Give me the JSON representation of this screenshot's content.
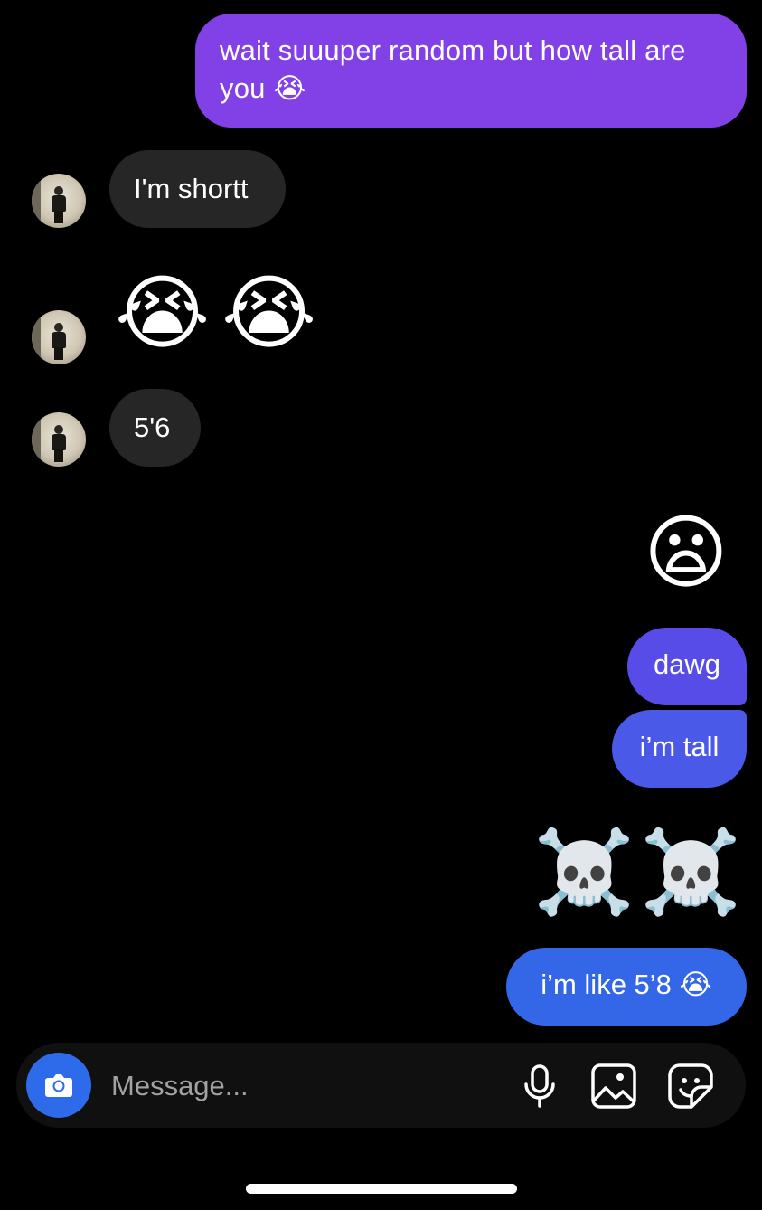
{
  "messages": [
    {
      "sender": "me",
      "text": "wait suuuper random but how tall are you",
      "emoji": "😭"
    },
    {
      "sender": "them",
      "text": "I'm shortt"
    },
    {
      "sender": "them",
      "emoji": [
        "😭",
        "😭"
      ]
    },
    {
      "sender": "them",
      "text": "5'6"
    },
    {
      "sender": "me",
      "emoji": [
        "😦"
      ]
    },
    {
      "sender": "me",
      "text": "dawg"
    },
    {
      "sender": "me",
      "text": "i’m tall"
    },
    {
      "sender": "me",
      "emoji": [
        "☠️",
        "☠️"
      ]
    },
    {
      "sender": "me",
      "text": "i’m like 5’8",
      "emoji": "😭"
    }
  ],
  "composer": {
    "placeholder": "Message...",
    "icons": {
      "camera": "camera-icon",
      "mic": "microphone-icon",
      "gallery": "gallery-icon",
      "sticker": "sticker-icon"
    }
  },
  "colors": {
    "background": "#000000",
    "incoming_bubble": "#262626",
    "outgoing_purple": "#8240e7",
    "outgoing_indigo": "#584ce8",
    "outgoing_blue": "#3367e8",
    "camera_button": "#2e6bea"
  }
}
